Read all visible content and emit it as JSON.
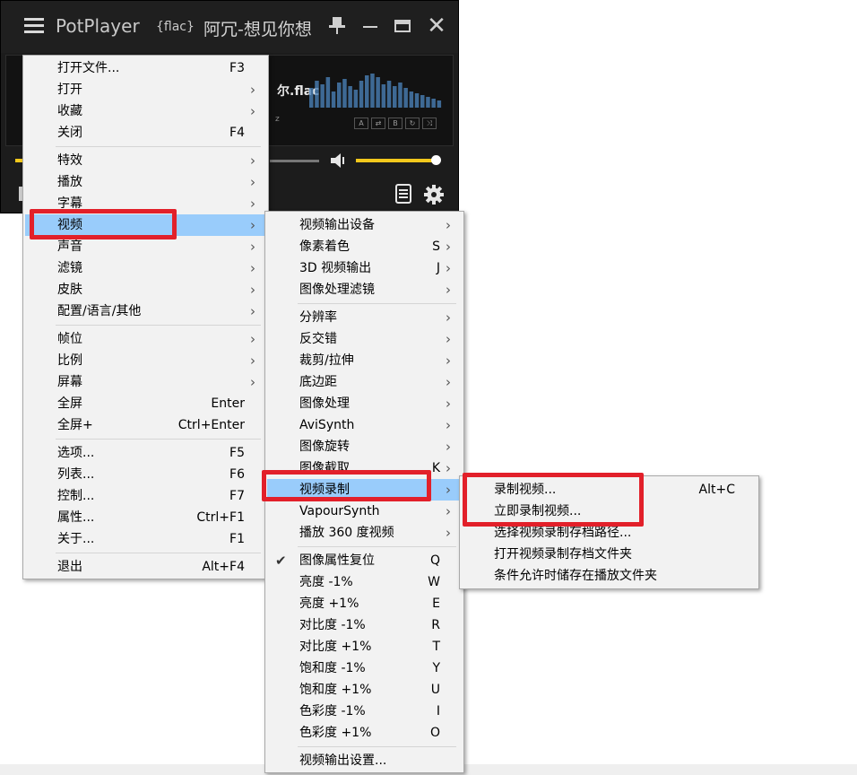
{
  "player": {
    "app_name": "PotPlayer",
    "format_badge": "{flac}",
    "window_title": "阿冗-想见你想",
    "filename_fragment": "尔.flac",
    "subinfo_fragment": "z",
    "mini_buttons": [
      "A",
      "⇄",
      "B",
      "↻",
      "⤨"
    ]
  },
  "main_menu": {
    "groups": [
      [
        {
          "label": "打开文件...",
          "shortcut": "F3",
          "submenu": false
        },
        {
          "label": "打开",
          "shortcut": "",
          "submenu": true
        },
        {
          "label": "收藏",
          "shortcut": "",
          "submenu": true
        },
        {
          "label": "关闭",
          "shortcut": "F4",
          "submenu": false
        }
      ],
      [
        {
          "label": "特效",
          "shortcut": "",
          "submenu": true
        },
        {
          "label": "播放",
          "shortcut": "",
          "submenu": true
        },
        {
          "label": "字幕",
          "shortcut": "",
          "submenu": true
        },
        {
          "label": "视频",
          "shortcut": "",
          "submenu": true,
          "highlighted": true
        },
        {
          "label": "声音",
          "shortcut": "",
          "submenu": true
        },
        {
          "label": "滤镜",
          "shortcut": "",
          "submenu": true
        },
        {
          "label": "皮肤",
          "shortcut": "",
          "submenu": true
        },
        {
          "label": "配置/语言/其他",
          "shortcut": "",
          "submenu": true
        }
      ],
      [
        {
          "label": "帧位",
          "shortcut": "",
          "submenu": true
        },
        {
          "label": "比例",
          "shortcut": "",
          "submenu": true
        },
        {
          "label": "屏幕",
          "shortcut": "",
          "submenu": true
        },
        {
          "label": "全屏",
          "shortcut": "Enter",
          "submenu": false
        },
        {
          "label": "全屏+",
          "shortcut": "Ctrl+Enter",
          "submenu": false
        }
      ],
      [
        {
          "label": "选项...",
          "shortcut": "F5",
          "submenu": false
        },
        {
          "label": "列表...",
          "shortcut": "F6",
          "submenu": false
        },
        {
          "label": "控制...",
          "shortcut": "F7",
          "submenu": false
        },
        {
          "label": "属性...",
          "shortcut": "Ctrl+F1",
          "submenu": false
        },
        {
          "label": "关于...",
          "shortcut": "F1",
          "submenu": false
        }
      ],
      [
        {
          "label": "退出",
          "shortcut": "Alt+F4",
          "submenu": false
        }
      ]
    ]
  },
  "video_menu": {
    "groups": [
      [
        {
          "label": "视频输出设备",
          "shortcut": "",
          "submenu": true
        },
        {
          "label": "像素着色",
          "shortcut": "S",
          "submenu": true
        },
        {
          "label": "3D 视频输出",
          "shortcut": "J",
          "submenu": true
        },
        {
          "label": "图像处理滤镜",
          "shortcut": "",
          "submenu": true
        }
      ],
      [
        {
          "label": "分辨率",
          "shortcut": "",
          "submenu": true
        },
        {
          "label": "反交错",
          "shortcut": "",
          "submenu": true
        },
        {
          "label": "裁剪/拉伸",
          "shortcut": "",
          "submenu": true
        },
        {
          "label": "底边距",
          "shortcut": "",
          "submenu": true
        },
        {
          "label": "图像处理",
          "shortcut": "",
          "submenu": true
        },
        {
          "label": "AviSynth",
          "shortcut": "",
          "submenu": true
        },
        {
          "label": "图像旋转",
          "shortcut": "",
          "submenu": true
        },
        {
          "label": "图像截取",
          "shortcut": "K",
          "submenu": true
        },
        {
          "label": "视频录制",
          "shortcut": "",
          "submenu": true,
          "highlighted": true
        },
        {
          "label": "VapourSynth",
          "shortcut": "",
          "submenu": true
        },
        {
          "label": "播放 360 度视频",
          "shortcut": "",
          "submenu": true
        }
      ],
      [
        {
          "label": "图像属性复位",
          "shortcut": "Q",
          "submenu": false,
          "checked": true
        },
        {
          "label": "亮度 -1%",
          "shortcut": "W",
          "submenu": false
        },
        {
          "label": "亮度 +1%",
          "shortcut": "E",
          "submenu": false
        },
        {
          "label": "对比度 -1%",
          "shortcut": "R",
          "submenu": false
        },
        {
          "label": "对比度 +1%",
          "shortcut": "T",
          "submenu": false
        },
        {
          "label": "饱和度 -1%",
          "shortcut": "Y",
          "submenu": false
        },
        {
          "label": "饱和度 +1%",
          "shortcut": "U",
          "submenu": false
        },
        {
          "label": "色彩度 -1%",
          "shortcut": "I",
          "submenu": false
        },
        {
          "label": "色彩度 +1%",
          "shortcut": "O",
          "submenu": false
        }
      ],
      [
        {
          "label": "视频输出设置...",
          "shortcut": "",
          "submenu": false
        }
      ]
    ]
  },
  "record_menu": {
    "groups": [
      [
        {
          "label": "录制视频...",
          "shortcut": "Alt+C",
          "submenu": false
        },
        {
          "label": "立即录制视频...",
          "shortcut": "",
          "submenu": false
        },
        {
          "label": "选择视频录制存档路径...",
          "shortcut": "",
          "submenu": false
        },
        {
          "label": "打开视频录制存档文件夹",
          "shortcut": "",
          "submenu": false
        },
        {
          "label": "条件允许时储存在播放文件夹",
          "shortcut": "",
          "submenu": false
        }
      ]
    ]
  },
  "colors": {
    "menu_bg": "#f2f2f2",
    "highlight": "#99ccfb",
    "annotation_red": "#e2202a",
    "accent_yellow": "#f2c81c",
    "player_bg": "#1c1c1c"
  }
}
